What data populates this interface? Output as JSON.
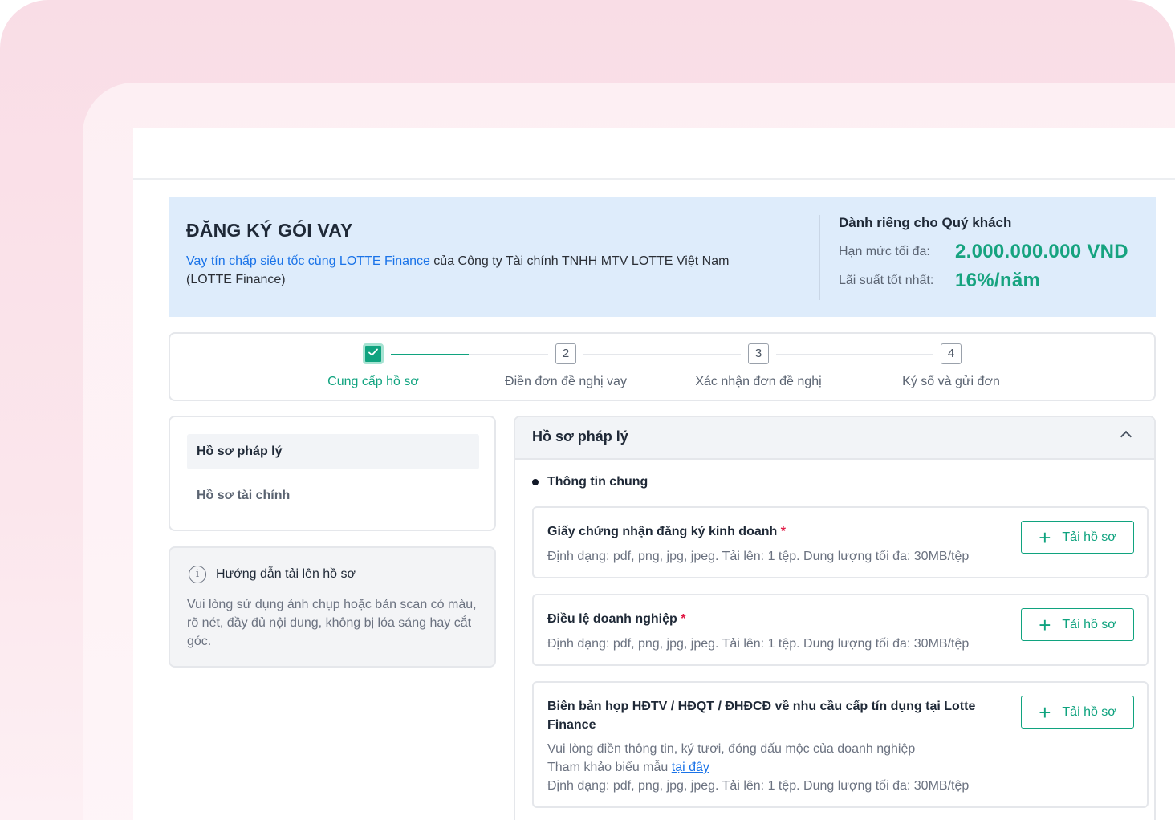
{
  "banner": {
    "title": "ĐĂNG KÝ GÓI VAY",
    "desc_link": "Vay tín chấp siêu tốc cùng LOTTE Finance",
    "desc_rest": " của Công ty Tài chính TNHH MTV LOTTE Việt Nam (LOTTE Finance)",
    "right_title": "Dành riêng cho Quý khách",
    "limit_label": "Hạn mức tối đa:",
    "limit_value": "2.000.000.000 VND",
    "rate_label": "Lãi suất tốt nhất:",
    "rate_value": "16%/năm"
  },
  "stepper": {
    "steps": [
      {
        "number": "✓",
        "label": "Cung cấp hồ sơ",
        "state": "done"
      },
      {
        "number": "2",
        "label": "Điền đơn đề nghị vay",
        "state": "pending"
      },
      {
        "number": "3",
        "label": "Xác nhận đơn đề nghị",
        "state": "pending"
      },
      {
        "number": "4",
        "label": "Ký số và gửi đơn",
        "state": "pending"
      }
    ]
  },
  "sidebar": {
    "items": [
      {
        "label": "Hồ sơ pháp lý"
      },
      {
        "label": "Hồ sơ tài chính"
      }
    ]
  },
  "guide": {
    "icon": "info-icon",
    "title": "Hướng dẫn tải lên hồ sơ",
    "text": "Vui lòng sử dụng ảnh chụp hoặc bản scan có màu, rõ nét, đầy đủ nội dung, không bị lóa sáng hay cắt góc."
  },
  "main": {
    "title": "Hồ sơ pháp lý",
    "section": "Thông tin chung",
    "upload_label": "Tải hồ sơ",
    "docs": [
      {
        "title": "Giấy chứng nhận đăng ký kinh doanh",
        "required": "*",
        "format": "Định dạng: pdf, png, jpg, jpeg. Tải lên: 1 tệp. Dung lượng tối đa: 30MB/tệp"
      },
      {
        "title": "Điều lệ doanh nghiệp",
        "required": "*",
        "format": "Định dạng: pdf, png, jpg, jpeg. Tải lên: 1 tệp. Dung lượng tối đa: 30MB/tệp"
      },
      {
        "title": "Biên bản họp HĐTV / HĐQT / ĐHĐCĐ về nhu cầu cấp tín dụng tại Lotte Finance",
        "note": "Vui lòng điền thông tin, ký tươi, đóng dấu mộc của doanh nghiệp",
        "template_prefix": "Tham khảo biểu mẫu ",
        "template_link": "tại đây",
        "format": "Định dạng: pdf, png, jpg, jpeg. Tải lên: 1 tệp. Dung lượng tối đa: 30MB/tệp"
      }
    ]
  },
  "colors": {
    "accent": "#10a37f",
    "link": "#1a73e8",
    "banner_bg": "#deecfb",
    "required": "#e11d48"
  }
}
